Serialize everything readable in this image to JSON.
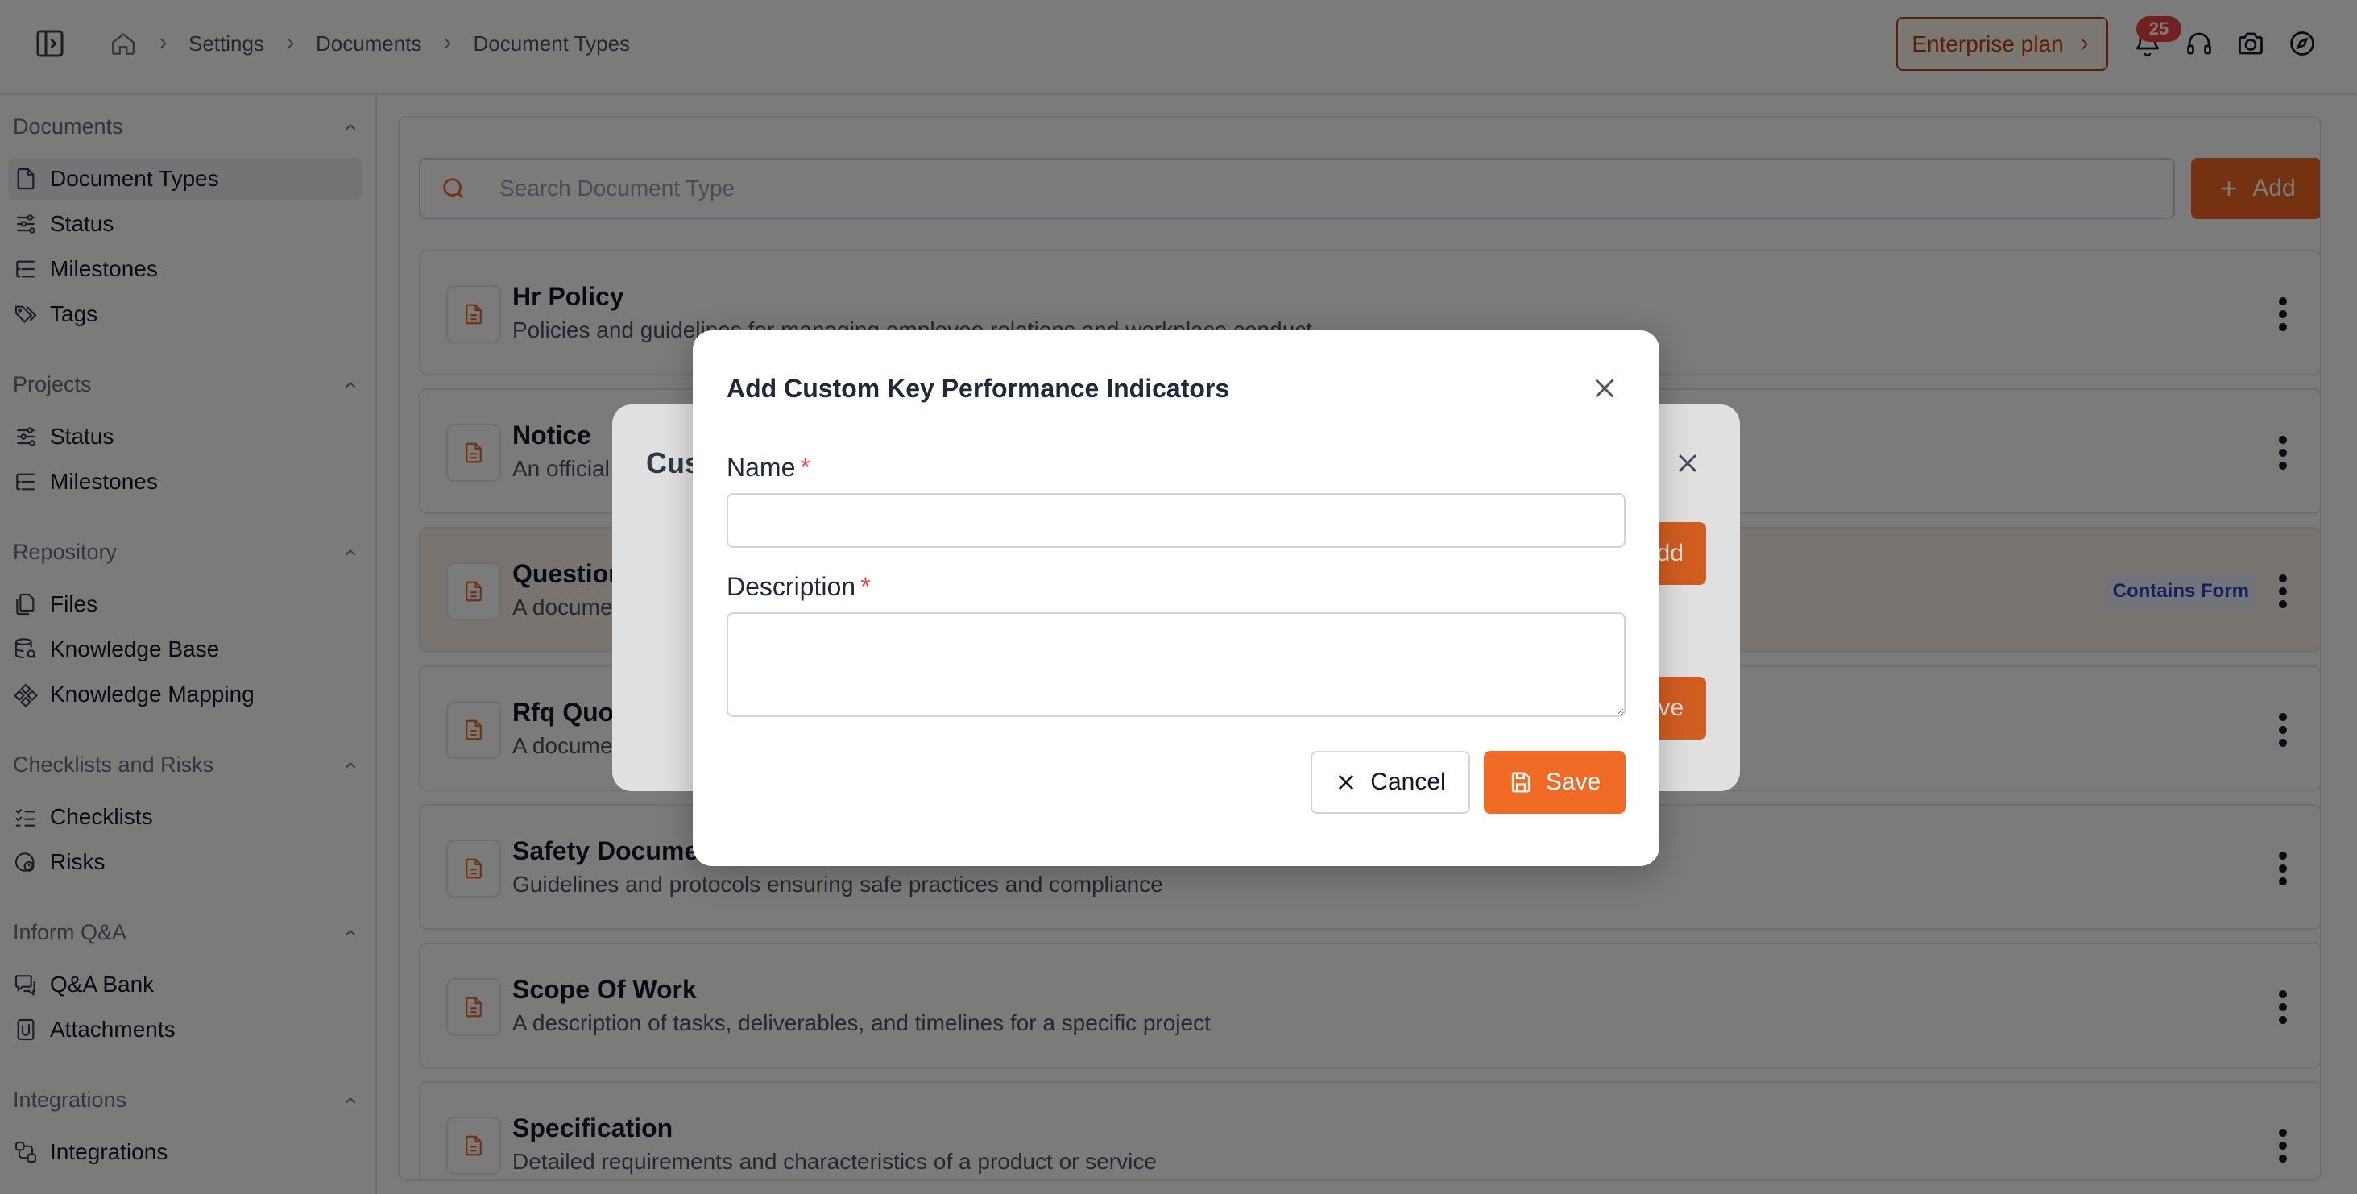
{
  "topbar": {
    "breadcrumb": [
      "Settings",
      "Documents",
      "Document Types"
    ],
    "plan_label": "Enterprise plan",
    "notification_count": "25",
    "icons": [
      "sidebar-toggle-icon",
      "home-icon",
      "bell-icon",
      "headset-icon",
      "camera-icon",
      "compass-icon"
    ]
  },
  "sidebar": {
    "sections": [
      {
        "title": "Documents",
        "items": [
          {
            "label": "Document Types",
            "icon": "file-icon",
            "active": true
          },
          {
            "label": "Status",
            "icon": "sliders-icon"
          },
          {
            "label": "Milestones",
            "icon": "list-tree-icon"
          },
          {
            "label": "Tags",
            "icon": "tags-icon"
          }
        ]
      },
      {
        "title": "Projects",
        "items": [
          {
            "label": "Status",
            "icon": "sliders-icon"
          },
          {
            "label": "Milestones",
            "icon": "list-tree-icon"
          }
        ]
      },
      {
        "title": "Repository",
        "items": [
          {
            "label": "Files",
            "icon": "files-icon"
          },
          {
            "label": "Knowledge Base",
            "icon": "database-search-icon"
          },
          {
            "label": "Knowledge Mapping",
            "icon": "network-icon"
          }
        ]
      },
      {
        "title": "Checklists and Risks",
        "items": [
          {
            "label": "Checklists",
            "icon": "checklist-icon"
          },
          {
            "label": "Risks",
            "icon": "risk-icon"
          }
        ]
      },
      {
        "title": "Inform Q&A",
        "items": [
          {
            "label": "Q&A Bank",
            "icon": "message-question-icon"
          },
          {
            "label": "Attachments",
            "icon": "attachment-icon"
          }
        ]
      },
      {
        "title": "Integrations",
        "items": [
          {
            "label": "Integrations",
            "icon": "integrations-icon"
          }
        ]
      }
    ]
  },
  "main": {
    "search_placeholder": "Search Document Type",
    "add_label": "Add",
    "rows": [
      {
        "title": "Hr Policy",
        "desc": "Policies and guidelines for managing employee relations and workplace conduct"
      },
      {
        "title": "Notice",
        "desc": "An official"
      },
      {
        "title": "Question",
        "desc": "A docume",
        "badge": "Contains Form",
        "highlight": true
      },
      {
        "title": "Rfq Quo",
        "desc": "A docume"
      },
      {
        "title": "Safety Docume",
        "desc": "Guidelines and protocols ensuring safe practices and compliance"
      },
      {
        "title": "Scope Of Work",
        "desc": "A description of tasks, deliverables, and timelines for a specific project"
      },
      {
        "title": "Specification",
        "desc": "Detailed requirements and characteristics of a product or service"
      }
    ]
  },
  "bg_dialog": {
    "title_partial": "Cus",
    "add_partial": "dd",
    "save_partial": "ve"
  },
  "modal": {
    "title": "Add Custom Key Performance Indicators",
    "name_label": "Name",
    "description_label": "Description",
    "required_mark": "*",
    "name_value": "",
    "description_value": "",
    "cancel_label": "Cancel",
    "save_label": "Save"
  },
  "colors": {
    "accent": "#f06a26",
    "plan": "#c2410c",
    "badge": "#ef4444",
    "form_badge_text": "#3046c9"
  }
}
